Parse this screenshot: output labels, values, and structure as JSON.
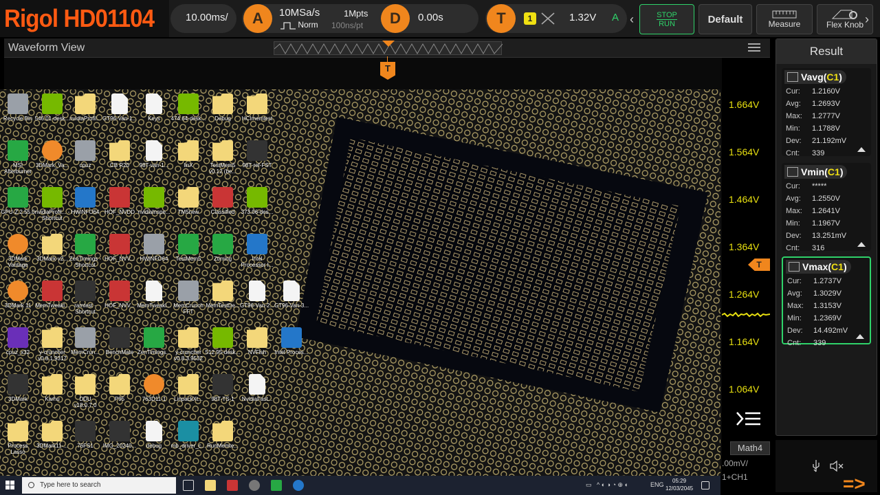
{
  "brand": {
    "title": "Rigol HD01104"
  },
  "top": {
    "timebase": "10.00ms/",
    "acq_icon": "A",
    "sample_rate": "10MSa/s",
    "mode": "Norm",
    "depth": "1Mpts",
    "resolution": "100ns/pt",
    "delay_icon": "D",
    "delay": "0.00s",
    "trig_icon": "T",
    "trig_channel": "1",
    "trig_level": "1.32V",
    "trig_mode": "A",
    "stop_label": "STOP",
    "run_label": "RUN",
    "default_label": "Default",
    "measure_label": "Measure",
    "flexknob_label": "Flex Knob",
    "colors": {
      "orange": "#f0861d",
      "yellow": "#e8e010",
      "green": "#2fd36a"
    }
  },
  "waveform": {
    "title": "Waveform View",
    "trigger_marker": "T",
    "level_marker": "T",
    "y_labels": [
      "1.664V",
      "1.564V",
      "1.464V",
      "1.364V",
      "1.264V",
      "1.164V",
      "1.064V"
    ]
  },
  "result": {
    "title": "Result",
    "cards": [
      {
        "name": "Vavg",
        "ch": "C1",
        "rows": [
          [
            "Cur:",
            "1.2160V"
          ],
          [
            "Avg:",
            "1.2693V"
          ],
          [
            "Max:",
            "1.2777V"
          ],
          [
            "Min:",
            "1.1788V"
          ],
          [
            "Dev:",
            "21.192mV"
          ],
          [
            "Cnt:",
            "339"
          ]
        ]
      },
      {
        "name": "Vmin",
        "ch": "C1",
        "rows": [
          [
            "Cur:",
            "*****"
          ],
          [
            "Avg:",
            "1.2550V"
          ],
          [
            "Max:",
            "1.2641V"
          ],
          [
            "Min:",
            "1.1967V"
          ],
          [
            "Dev:",
            "13.251mV"
          ],
          [
            "Cnt:",
            "316"
          ]
        ]
      },
      {
        "name": "Vmax",
        "ch": "C1",
        "rows": [
          [
            "Cur:",
            "1.2737V"
          ],
          [
            "Avg:",
            "1.3029V"
          ],
          [
            "Max:",
            "1.3153V"
          ],
          [
            "Min:",
            "1.2369V"
          ],
          [
            "Dev:",
            "14.492mV"
          ],
          [
            "Cnt:",
            "339"
          ]
        ]
      }
    ]
  },
  "math": {
    "tab": "Math4",
    "value": ".00mV/",
    "expr": "1+CH1"
  },
  "desktop": {
    "icons": [
      [
        "Recycle Bin",
        "gray"
      ],
      [
        "546.01-desk...",
        "nvidia"
      ],
      [
        "nvidiaProfil...",
        "folder"
      ],
      [
        "GT96-Van-1...",
        "doc"
      ],
      [
        "Keys",
        "doc"
      ],
      [
        "474.64-desk...",
        "nvidia"
      ],
      [
        "Debug",
        "folder"
      ],
      [
        "HCImemtest",
        "folder"
      ],
      [
        "MSI Afterburner",
        "green"
      ],
      [
        "3DMark_Va...",
        "orange"
      ],
      [
        "cpuz",
        "gray"
      ],
      [
        "CB R20",
        "folder"
      ],
      [
        "98T-van-1...",
        "doc"
      ],
      [
        "linX",
        "folder"
      ],
      [
        "TestMem5 v0.12 (be...",
        "folder"
      ],
      [
        "98T-ref-FST",
        "dark"
      ],
      [
        "GPU-Z.2.55.0",
        "green"
      ],
      [
        "nvidiaProfil... - Shortcut",
        "nvidia"
      ],
      [
        "HWiNFO64",
        "blue"
      ],
      [
        "HOF_NVDD",
        "red"
      ],
      [
        "nvidiaInspe...",
        "nvidia"
      ],
      [
        "TM5new",
        "folder"
      ],
      [
        "Classified",
        "red"
      ],
      [
        "373.06-des...",
        "nvidia"
      ],
      [
        "3DMark Vantage",
        "orange"
      ],
      [
        "3DMark-v2...",
        "folder"
      ],
      [
        "ZenTimings - Shortcut",
        "green"
      ],
      [
        "HOF_NVV...",
        "red"
      ],
      [
        "HWiNFO64",
        "gray"
      ],
      [
        "TestMem5",
        "green"
      ],
      [
        "Ztiming",
        "green"
      ],
      [
        "Intel Processor I...",
        "blue"
      ],
      [
        "3DMark 11",
        "orange"
      ],
      [
        "MemTweakl...",
        "red"
      ],
      [
        "ramtest - Shortcut",
        "dark"
      ],
      [
        "HOF_NVV...",
        "red"
      ],
      [
        "MemTweakl...",
        "doc"
      ],
      [
        "MemCrunch FFT",
        "gray"
      ],
      [
        "MemTestDe...",
        "folder"
      ],
      [
        "GT96-Van-2...",
        "doc"
      ],
      [
        "GT96-Van-3...",
        "doc"
      ],
      [
        "cpuz_x32",
        "purple"
      ],
      [
        "y-cruncher v0.8.1.9317",
        "folder"
      ],
      [
        "MemCrun...",
        "gray"
      ],
      [
        "BenchMate",
        "dark"
      ],
      [
        "ZenTimings...",
        "green"
      ],
      [
        "y-cruncher v0.8.3.9532",
        "folder"
      ],
      [
        "512.95-desk...",
        "nvidia"
      ],
      [
        "NVFlsh",
        "folder"
      ],
      [
        "Intel Proces...",
        "blue"
      ],
      [
        "3DMark",
        "dark"
      ],
      [
        "Karhu",
        "folder"
      ],
      [
        "DDU v18.0.7.0",
        "folder"
      ],
      [
        "P95",
        "folder"
      ],
      [
        "763D11-1",
        "orange"
      ],
      [
        "LinpackXt...",
        "folder"
      ],
      [
        "98T-TS-1",
        "dark"
      ],
      [
        "NvidiaFast...",
        "doc"
      ],
      [
        "Process Lasso",
        "folder"
      ],
      [
        "3DMark11-...",
        "folder"
      ],
      [
        "76FS1",
        "dark"
      ],
      [
        "IMG_20240...",
        "dark"
      ],
      [
        "debug",
        "doc"
      ],
      [
        "mb_driver_c...",
        "teal"
      ],
      [
        "RunMemte...",
        "folder"
      ]
    ]
  },
  "taskbar": {
    "search_placeholder": "Type here to search",
    "lang": "ENG",
    "time": "05:29",
    "date": "12/03/2045"
  }
}
